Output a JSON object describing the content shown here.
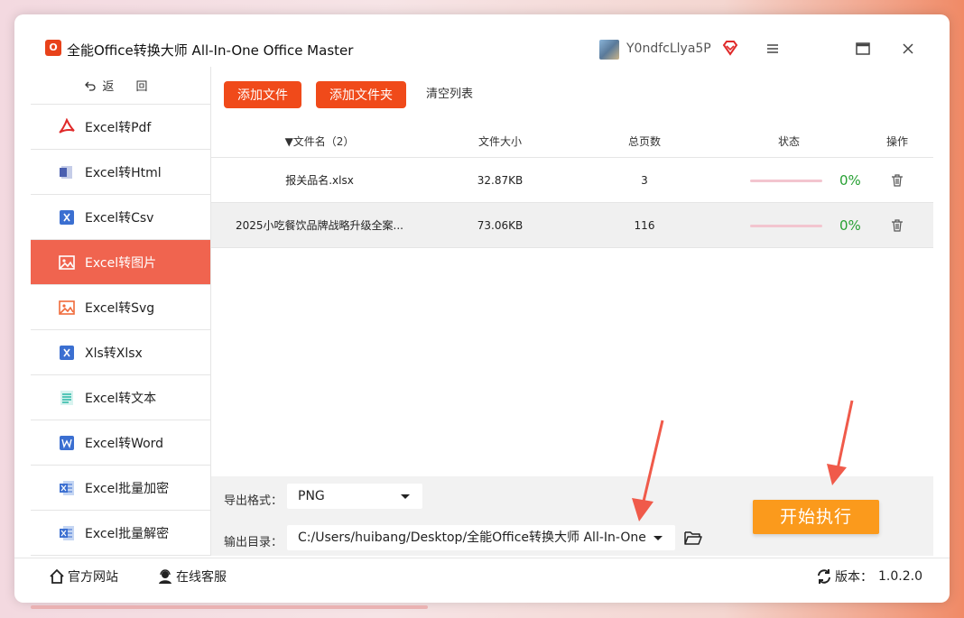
{
  "app": {
    "logo_text": "O",
    "title": "全能Office转换大师 All-In-One Office Master",
    "username": "Y0ndfcLlya5P"
  },
  "sidebar": {
    "back_label": "返 回",
    "items": [
      {
        "label": "Excel转Pdf",
        "icon": "pdf-icon"
      },
      {
        "label": "Excel转Html",
        "icon": "html-icon"
      },
      {
        "label": "Excel转Csv",
        "icon": "excel-icon"
      },
      {
        "label": "Excel转图片",
        "icon": "image-icon",
        "active": true
      },
      {
        "label": "Excel转Svg",
        "icon": "image-icon"
      },
      {
        "label": "Xls转Xlsx",
        "icon": "excel-icon"
      },
      {
        "label": "Excel转文本",
        "icon": "text-icon"
      },
      {
        "label": "Excel转Word",
        "icon": "word-icon"
      },
      {
        "label": "Excel批量加密",
        "icon": "excel-lock-icon"
      },
      {
        "label": "Excel批量解密",
        "icon": "excel-unlock-icon"
      }
    ]
  },
  "toolbar": {
    "add_file": "添加文件",
    "add_folder": "添加文件夹",
    "clear_list": "清空列表"
  },
  "table": {
    "headers": {
      "name": "▼文件名（2）",
      "size": "文件大小",
      "pages": "总页数",
      "status": "状态",
      "op": "操作"
    },
    "rows": [
      {
        "name": "报关品名.xlsx",
        "size": "32.87KB",
        "pages": "3",
        "progress": "0%"
      },
      {
        "name": "2025小吃餐饮品牌战略升级全案...",
        "size": "73.06KB",
        "pages": "116",
        "progress": "0%"
      }
    ]
  },
  "options": {
    "format_label": "导出格式：",
    "format_value": "PNG",
    "dir_label": "输出目录：",
    "dir_value": "C:/Users/huibang/Desktop/全能Office转换大师 All-In-One",
    "start_label": "开始执行"
  },
  "footer": {
    "site": "官方网站",
    "service": "在线客服",
    "version_label": "版本：",
    "version_value": "1.0.2.0"
  },
  "colors": {
    "accent": "#f04a1a",
    "active_nav": "#f0644f",
    "start_button": "#fb9a1c",
    "progress_text": "#27a033",
    "arrow": "#f05a4a"
  }
}
